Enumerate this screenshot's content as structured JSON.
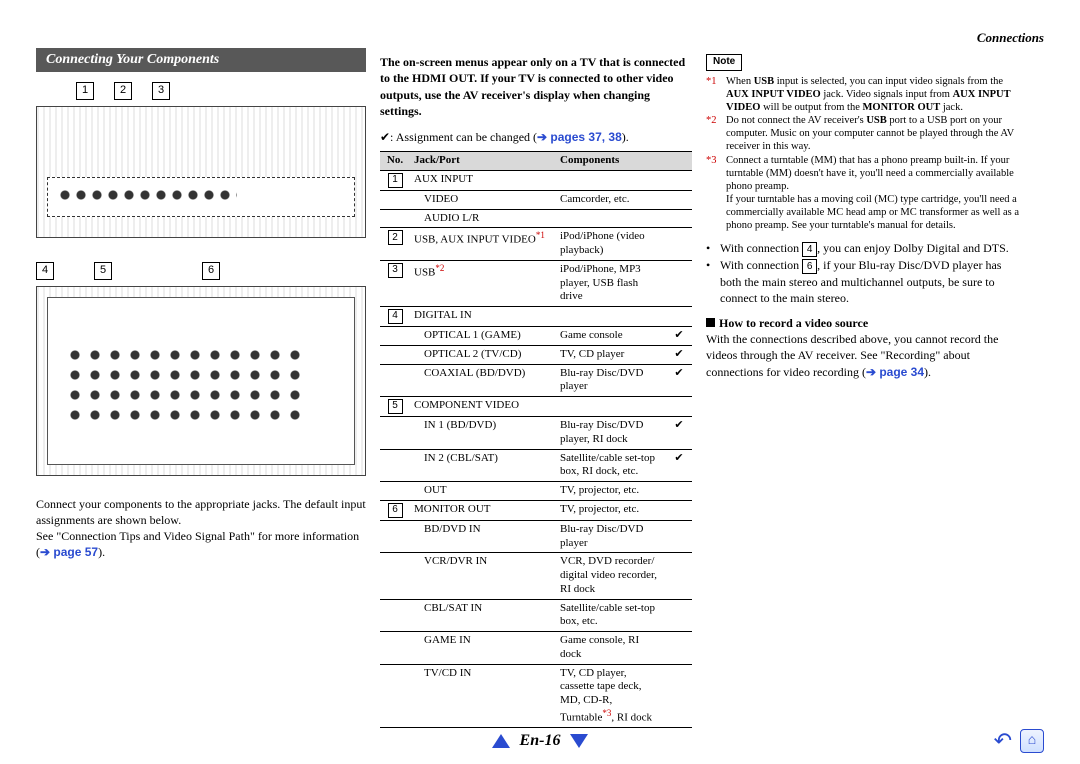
{
  "header": {
    "section": "Connections"
  },
  "banner": "Connecting Your Components",
  "callouts_top": [
    "1",
    "2",
    "3"
  ],
  "callouts_bottom": [
    "4",
    "5",
    "6"
  ],
  "left_paras": {
    "p1": "Connect your components to the appropriate jacks. The default input assignments are shown below.",
    "p2a": "See \"Connection Tips and Video Signal Path\" for more information (",
    "p2_link": "➔ page 57",
    "p2b": ")."
  },
  "mid": {
    "intro_bold": "The on-screen menus appear only on a TV that is connected to the HDMI OUT. If your TV is connected to other video outputs, use the AV receiver's display when changing settings.",
    "assign_prefix": "✔: Assignment can be changed (",
    "assign_link": "➔ pages 37, 38",
    "assign_suffix": ").",
    "table": {
      "head": [
        "No.",
        "Jack/Port",
        "Components",
        ""
      ],
      "rows": [
        {
          "no": "1",
          "jack": "AUX INPUT",
          "comp": "",
          "chk": ""
        },
        {
          "no": "",
          "jack": "VIDEO",
          "comp": "Camcorder, etc.",
          "chk": "",
          "indent": true
        },
        {
          "no": "",
          "jack": "AUDIO L/R",
          "comp": "",
          "chk": "",
          "indent": true
        },
        {
          "no": "2",
          "jack": "USB, AUX INPUT VIDEO",
          "sup": "*1",
          "comp": "iPod/iPhone (video playback)",
          "chk": ""
        },
        {
          "no": "3",
          "jack": "USB",
          "sup": "*2",
          "comp": "iPod/iPhone, MP3 player, USB flash drive",
          "chk": ""
        },
        {
          "no": "4",
          "jack": "DIGITAL IN",
          "comp": "",
          "chk": ""
        },
        {
          "no": "",
          "jack": "OPTICAL 1 (GAME)",
          "comp": "Game console",
          "chk": "✔",
          "indent": true
        },
        {
          "no": "",
          "jack": "OPTICAL 2 (TV/CD)",
          "comp": "TV, CD player",
          "chk": "✔",
          "indent": true
        },
        {
          "no": "",
          "jack": "COAXIAL (BD/DVD)",
          "comp": "Blu-ray Disc/DVD player",
          "chk": "✔",
          "indent": true
        },
        {
          "no": "5",
          "jack": "COMPONENT VIDEO",
          "comp": "",
          "chk": ""
        },
        {
          "no": "",
          "jack": "IN 1 (BD/DVD)",
          "comp": "Blu-ray Disc/DVD player, RI dock",
          "chk": "✔",
          "indent": true
        },
        {
          "no": "",
          "jack": "IN 2 (CBL/SAT)",
          "comp": "Satellite/cable set-top box, RI dock, etc.",
          "chk": "✔",
          "indent": true
        },
        {
          "no": "",
          "jack": "OUT",
          "comp": "TV, projector, etc.",
          "chk": "",
          "indent": true
        },
        {
          "no": "6",
          "jack": "MONITOR OUT",
          "comp": "TV, projector, etc.",
          "chk": ""
        },
        {
          "no": "",
          "jack": "BD/DVD IN",
          "comp": "Blu-ray Disc/DVD player",
          "chk": "",
          "indent": true
        },
        {
          "no": "",
          "jack": "VCR/DVR IN",
          "comp": "VCR, DVD recorder/ digital video recorder, RI dock",
          "chk": "",
          "indent": true
        },
        {
          "no": "",
          "jack": "CBL/SAT IN",
          "comp": "Satellite/cable set-top box, etc.",
          "chk": "",
          "indent": true
        },
        {
          "no": "",
          "jack": "GAME IN",
          "comp": "Game console, RI dock",
          "chk": "",
          "indent": true
        },
        {
          "no": "",
          "jack": "TV/CD IN",
          "comp": "TV, CD player, cassette tape deck, MD, CD-R, Turntable",
          "sup_end": "*3",
          "comp_end": ", RI dock",
          "chk": "",
          "indent": true
        }
      ]
    }
  },
  "right": {
    "note_label": "Note",
    "footnotes": [
      {
        "num": "*1",
        "text_parts": [
          "When ",
          {
            "b": "USB"
          },
          " input is selected, you can input video signals from the ",
          {
            "b": "AUX INPUT VIDEO"
          },
          " jack. Video signals input from ",
          {
            "b": "AUX INPUT VIDEO"
          },
          " will be output from the ",
          {
            "b": "MONITOR OUT"
          },
          " jack."
        ]
      },
      {
        "num": "*2",
        "text": "Do not connect the AV receiver's USB port to a USB port on your computer. Music on your computer cannot be played through the AV receiver in this way.",
        "bold_sub": "USB"
      },
      {
        "num": "*3",
        "text": "Connect a turntable (MM) that has a phono preamp built-in. If your turntable (MM) doesn't have it, you'll need a commercially available phono preamp.\nIf your turntable has a moving coil (MC) type cartridge, you'll need a commercially available MC head amp or MC transformer as well as a phono preamp. See your turntable's manual for details."
      }
    ],
    "bullets": [
      {
        "pre": "With connection ",
        "num": "4",
        "post": ", you can enjoy Dolby Digital and DTS."
      },
      {
        "pre": "With connection ",
        "num": "6",
        "post": ", if your Blu-ray Disc/DVD player has both the main stereo and multichannel outputs, be sure to connect to the main stereo."
      }
    ],
    "howto_head": "How to record a video source",
    "howto_body_a": "With the connections described above, you cannot record the videos through the AV receiver. See \"Recording\" about connections for video recording (",
    "howto_link": "➔ page 34",
    "howto_body_b": ")."
  },
  "footer": {
    "page": "En-16"
  }
}
